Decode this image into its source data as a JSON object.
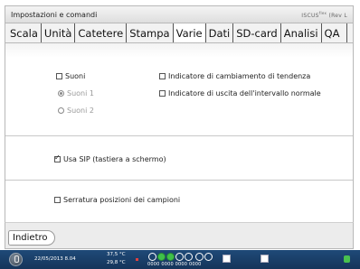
{
  "window": {
    "title": "Impostazioni e comandi",
    "brand": "ISCUS",
    "brand_sup": "flex",
    "brand_suffix": "(Rev L"
  },
  "tabs": [
    {
      "label": "Scala",
      "active": false
    },
    {
      "label": "Unità",
      "active": false
    },
    {
      "label": "Catetere",
      "active": false
    },
    {
      "label": "Stampa",
      "active": false
    },
    {
      "label": "Varie",
      "active": true
    },
    {
      "label": "Dati",
      "active": false
    },
    {
      "label": "SD-card",
      "active": false
    },
    {
      "label": "Analisi",
      "active": false
    },
    {
      "label": "QA",
      "active": false
    }
  ],
  "options": {
    "suoni": {
      "label": "Suoni",
      "checked": false
    },
    "suoni1": {
      "label": "Suoni 1",
      "selected": true,
      "disabled": true
    },
    "suoni2": {
      "label": "Suoni 2",
      "selected": false,
      "disabled": true
    },
    "trend_indicator": {
      "label": "Indicatore di cambiamento di tendenza",
      "checked": false
    },
    "range_indicator": {
      "label": "Indicatore di uscita dell'intervallo normale",
      "checked": false
    },
    "sip": {
      "label": "Usa SIP (tastiera a schermo)",
      "checked": true
    },
    "lock": {
      "label": "Serratura posizioni dei campioni",
      "checked": false
    }
  },
  "footer": {
    "back_label": "Indietro"
  },
  "status": {
    "date": "22/05/2013 8.04",
    "temp1": "37,5 °C",
    "temp2": "29,8 °C",
    "digits": "0000 0000 0000 0000"
  }
}
